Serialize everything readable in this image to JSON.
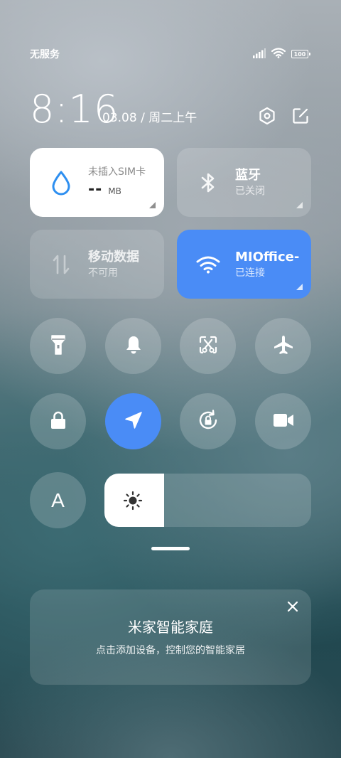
{
  "status_bar": {
    "carrier": "无服务",
    "battery": "100",
    "icons": [
      "signal-bars-icon",
      "wifi-icon",
      "battery-icon"
    ]
  },
  "header": {
    "time": "8:16",
    "date": "03.08 / 周二上午",
    "icons": [
      "settings-hexagon-icon",
      "edit-icon"
    ]
  },
  "tiles": {
    "sim": {
      "label": "未插入SIM卡",
      "value": "--",
      "unit": "MB",
      "icon": "water-drop-icon",
      "accent": "#2e8ff0"
    },
    "bluetooth": {
      "label": "蓝牙",
      "status": "已关闭",
      "icon": "bluetooth-icon"
    },
    "mobile_data": {
      "label": "移动数据",
      "status": "不可用",
      "icon": "data-arrows-icon"
    },
    "wifi": {
      "label": "MIOffice-",
      "status": "已连接",
      "icon": "wifi-icon",
      "color": "#4a8cf6"
    }
  },
  "toggles": [
    {
      "name": "flashlight",
      "icon": "flashlight-icon",
      "active": false
    },
    {
      "name": "silent",
      "icon": "bell-icon",
      "active": false
    },
    {
      "name": "screenshot",
      "icon": "screenshot-scissors-icon",
      "active": false
    },
    {
      "name": "airplane",
      "icon": "airplane-icon",
      "active": false
    },
    {
      "name": "lock-screen",
      "icon": "lock-icon",
      "active": false
    },
    {
      "name": "location",
      "icon": "location-arrow-icon",
      "active": true
    },
    {
      "name": "rotation-lock",
      "icon": "rotation-lock-icon",
      "active": false
    },
    {
      "name": "screen-record",
      "icon": "video-camera-icon",
      "active": false
    }
  ],
  "auto_brightness": {
    "label": "A"
  },
  "brightness": {
    "level": 0.29,
    "icon": "sun-icon"
  },
  "smart_home_card": {
    "title": "米家智能家庭",
    "subtitle": "点击添加设备，控制您的智能家居",
    "close_icon": "close-icon"
  }
}
